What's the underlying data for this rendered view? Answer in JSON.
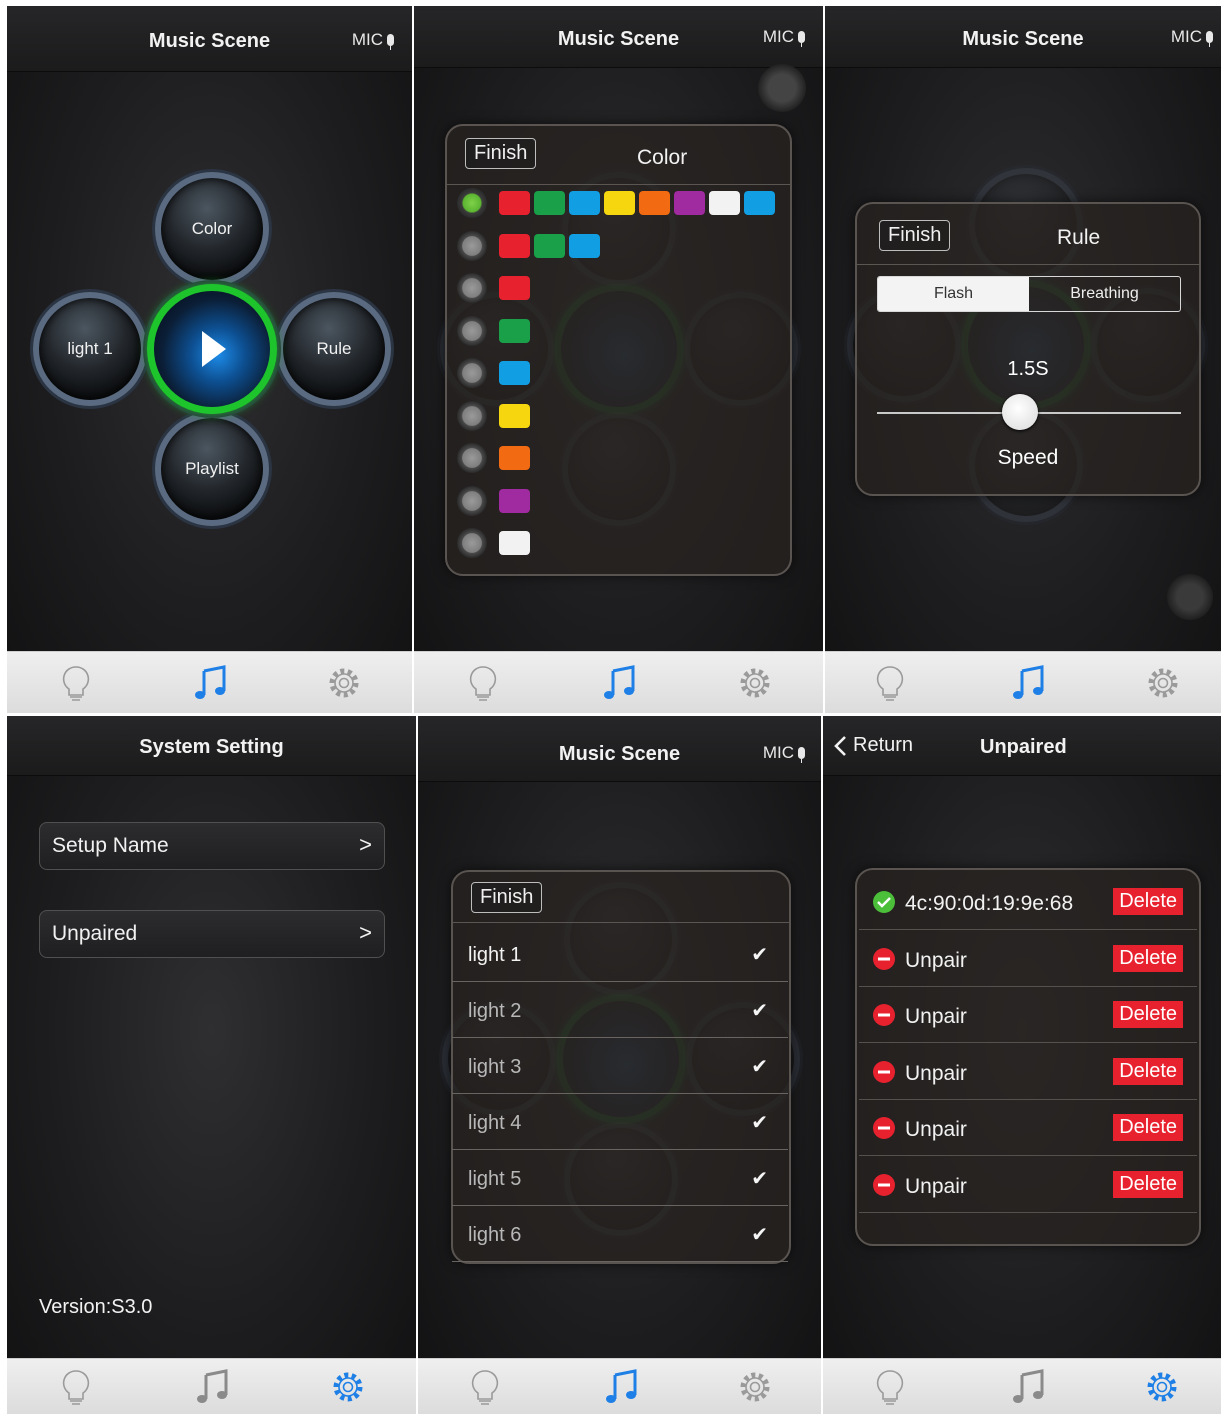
{
  "music_title": "Music Scene",
  "mic_label": "MIC",
  "controller": {
    "color_label": "Color",
    "light_label": "light 1",
    "rule_label": "Rule",
    "playlist_label": "Playlist"
  },
  "finish_label": "Finish",
  "color_popup": {
    "title": "Color",
    "rows": [
      {
        "selected": true,
        "colors": [
          "#e8212e",
          "#1aa048",
          "#129ee2",
          "#f5d60f",
          "#f26a12",
          "#a02ba0",
          "#f2f2f2",
          "#129ee2"
        ]
      },
      {
        "selected": false,
        "colors": [
          "#e8212e",
          "#1aa048",
          "#129ee2"
        ]
      },
      {
        "selected": false,
        "colors": [
          "#e8212e"
        ]
      },
      {
        "selected": false,
        "colors": [
          "#1aa048"
        ]
      },
      {
        "selected": false,
        "colors": [
          "#129ee2"
        ]
      },
      {
        "selected": false,
        "colors": [
          "#f5d60f"
        ]
      },
      {
        "selected": false,
        "colors": [
          "#f26a12"
        ]
      },
      {
        "selected": false,
        "colors": [
          "#a02ba0"
        ]
      },
      {
        "selected": false,
        "colors": [
          "#f2f2f2"
        ]
      }
    ]
  },
  "rule_popup": {
    "title": "Rule",
    "seg_flash": "Flash",
    "seg_breathing": "Breathing",
    "selected_mode": "Flash",
    "speed_value": "1.5S",
    "speed_label": "Speed",
    "speed_level": 0.47
  },
  "system": {
    "title": "System Setting",
    "setup_name": "Setup Name",
    "unpaired": "Unpaired",
    "chevron": ">",
    "version": "Version:S3.0"
  },
  "lights_popup": {
    "items": [
      {
        "label": "light 1",
        "checked": true
      },
      {
        "label": "light 2",
        "checked": true
      },
      {
        "label": "light 3",
        "checked": true
      },
      {
        "label": "light 4",
        "checked": true
      },
      {
        "label": "light 5",
        "checked": true
      },
      {
        "label": "light 6",
        "checked": true
      }
    ]
  },
  "unpaired_screen": {
    "return_label": "Return",
    "title": "Unpaired",
    "delete_label": "Delete",
    "devices": [
      {
        "status": "paired",
        "label": "4c:90:0d:19:9e:68"
      },
      {
        "status": "unpaired",
        "label": "Unpair"
      },
      {
        "status": "unpaired",
        "label": "Unpair"
      },
      {
        "status": "unpaired",
        "label": "Unpair"
      },
      {
        "status": "unpaired",
        "label": "Unpair"
      },
      {
        "status": "unpaired",
        "label": "Unpair"
      }
    ]
  },
  "tabs": [
    "bulb-icon",
    "music-note-icon",
    "gear-icon"
  ],
  "colors": {
    "accent_blue": "#1e7fe6",
    "tab_inactive": "#9a9a9a",
    "ring_green": "#1ec42b",
    "delete_red": "#e8212e"
  }
}
